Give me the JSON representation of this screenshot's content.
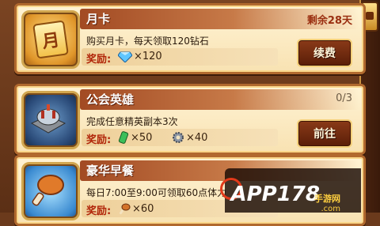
{
  "cards": [
    {
      "title": "月卡",
      "status": "剩余28天",
      "description": "购买月卡，每天领取120钻石",
      "reward_label": "奖励:",
      "rewards": [
        {
          "icon": "diamond-icon",
          "qty": "×120"
        }
      ],
      "button": "续费",
      "icon_glyph": "月"
    },
    {
      "title": "公会英雄",
      "status": "0/3",
      "description": "完成任意精英副本3次",
      "reward_label": "奖励:",
      "rewards": [
        {
          "icon": "green-potion-icon",
          "qty": "×50"
        },
        {
          "icon": "gear-icon",
          "qty": "×40"
        }
      ],
      "button": "前往"
    },
    {
      "title": "豪华早餐",
      "status": "",
      "description": "每日7:00至9:00可领取60点体力",
      "reward_label": "奖励:",
      "rewards": [
        {
          "icon": "drumstick-icon",
          "qty": "×60"
        }
      ]
    }
  ],
  "watermark": {
    "main": "APP178",
    "sub": "手游网",
    "sub2": ".com"
  }
}
